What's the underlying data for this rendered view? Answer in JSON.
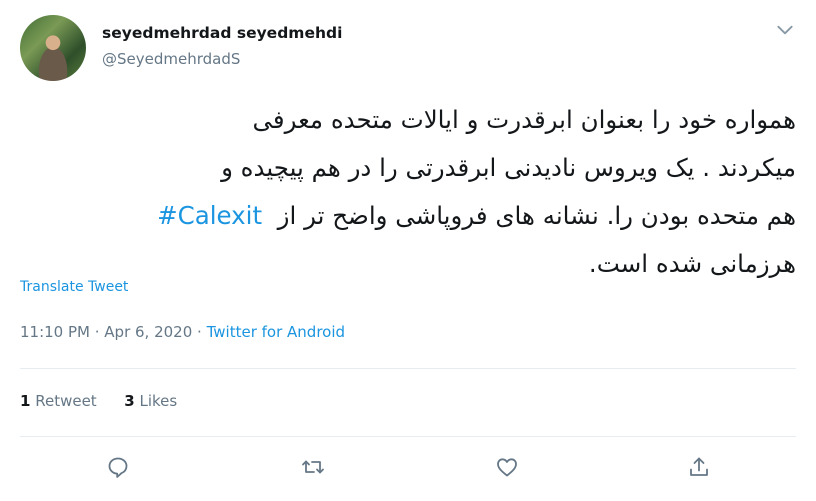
{
  "user": {
    "name": "seyedmehrdad seyedmehdi",
    "handle": "@SeyedmehrdadS"
  },
  "tweet": {
    "lines": [
      "همواره خود را بعنوان  ابرقدرت و ایالات متحده معرفی",
      "میکردند . یک ویروس نادیدنی ابرقدرتی را در هم پیچیده و",
      "هم متحده بودن را. نشانه های فروپاشی واضح تر از",
      "هرزمانی شده است."
    ],
    "hashtag": "#Calexit",
    "translate_label": "Translate Tweet"
  },
  "meta": {
    "time": "11:10 PM",
    "separator1": " · ",
    "date": "Apr 6, 2020",
    "separator2": " · ",
    "source": "Twitter for Android"
  },
  "stats": {
    "retweets_count": "1",
    "retweets_label": "Retweet",
    "likes_count": "3",
    "likes_label": "Likes"
  },
  "icons": {
    "more": "chevron-down-icon",
    "reply": "reply-icon",
    "retweet": "retweet-icon",
    "like": "heart-icon",
    "share": "share-icon"
  },
  "colors": {
    "link": "#1b95e0",
    "text": "#14171a",
    "muted": "#657786",
    "divider": "#e6ecf0"
  }
}
